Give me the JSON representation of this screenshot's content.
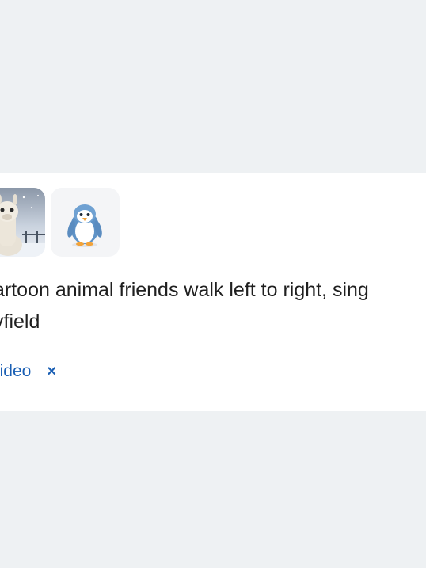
{
  "card": {
    "thumbnails": [
      {
        "icon": "llama-in-snow-image"
      },
      {
        "icon": "cartoon-penguin-image"
      }
    ],
    "prompt_text": "artoon animal friends walk left to right, sing\nvfield",
    "chip": {
      "label": "Video",
      "close_glyph": "×"
    }
  },
  "colors": {
    "background": "#eef1f3",
    "card": "#ffffff",
    "text": "#1f1f1f",
    "accent": "#1a5fb4"
  }
}
